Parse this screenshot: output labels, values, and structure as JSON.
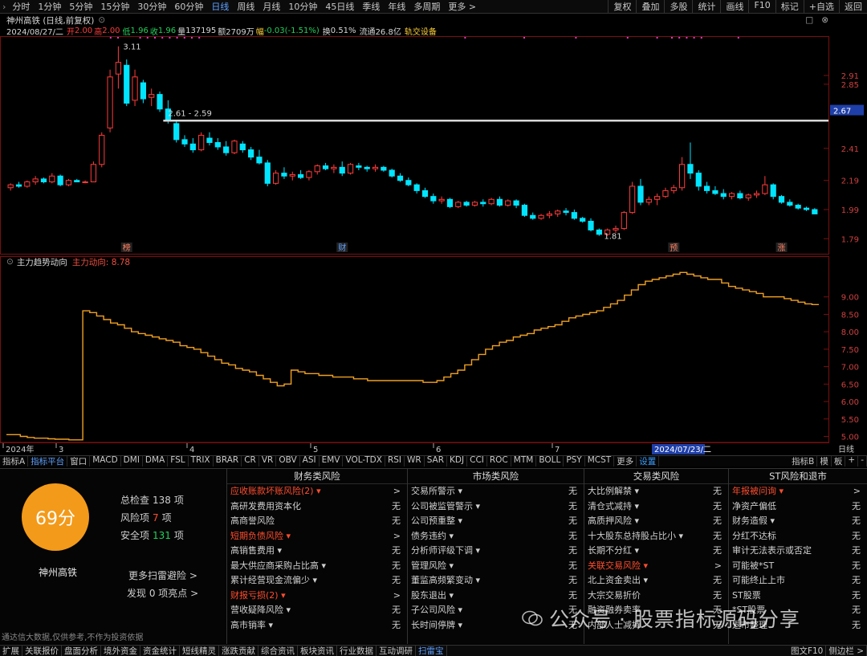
{
  "toolbar": {
    "timeframes": [
      "分时",
      "1分钟",
      "5分钟",
      "15分钟",
      "30分钟",
      "60分钟",
      "日线",
      "周线",
      "月线",
      "10分钟",
      "45日线",
      "季线",
      "年线",
      "多周期",
      "更多 >"
    ],
    "active_timeframe": "日线",
    "right_buttons": [
      "复权",
      "叠加",
      "多股",
      "统计",
      "画线",
      "F10",
      "标记",
      "+自选",
      "返回"
    ]
  },
  "header": {
    "title": "神州高铁 (日线,前复权)",
    "date": "2024/08/27/二",
    "open_label": "开",
    "open": "2.00",
    "high_label": "高",
    "high": "2.00",
    "low_label": "低",
    "low": "1.96",
    "close_label": "收",
    "close": "1.96",
    "volume_label": "量",
    "volume": "137195",
    "amount_label": "额",
    "amount": "2709万",
    "change_label": "幅",
    "change": "-0.03(-1.51%)",
    "turnover_label": "换",
    "turnover": "0.51%",
    "float_label": "流通",
    "float": "26.8亿",
    "sector": "轨交设备"
  },
  "price_chart": {
    "y_ticks": [
      "2.91",
      "2.85",
      "2.41",
      "2.19",
      "1.99",
      "1.79"
    ],
    "current_price_tag": "2.67",
    "peak_label": "3.11",
    "low_label": "1.81",
    "range_label": "2.61 - 2.59",
    "event_markers": [
      "榜",
      "财",
      "预",
      "涨"
    ]
  },
  "indicator": {
    "name": "主力趋势动向",
    "series_label": "主力动向: 8.78",
    "y_ticks": [
      "9.00",
      "8.50",
      "8.00",
      "7.50",
      "7.00",
      "6.50",
      "6.00",
      "5.50",
      "5.00"
    ]
  },
  "date_axis": {
    "labels": [
      "2024年",
      "3",
      "4",
      "5",
      "6",
      "7"
    ],
    "highlight_date": "2024/07/23/二",
    "right_label": "日线"
  },
  "indicator_tabs": {
    "items": [
      "指标A",
      "指标平台",
      "窗口",
      "MACD",
      "DMI",
      "DMA",
      "FSL",
      "TRIX",
      "BRAR",
      "CR",
      "VR",
      "OBV",
      "ASI",
      "EMV",
      "VOL-TDX",
      "RSI",
      "WR",
      "SAR",
      "KDJ",
      "CCI",
      "ROC",
      "MTM",
      "BOLL",
      "PSY",
      "MCST",
      "更多",
      "设置"
    ],
    "right_items": [
      "指标B",
      "模",
      "板",
      "+",
      "-"
    ]
  },
  "scan": {
    "score": "69分",
    "stock_name": "神州高铁",
    "total_label": "总检查",
    "total": "138",
    "total_unit": "项",
    "risk_label": "风险项",
    "risk": "7",
    "risk_unit": "项",
    "safe_label": "安全项",
    "safe": "131",
    "safe_unit": "项",
    "more_scan": "更多扫雷避险 >",
    "discover": "发现 0 项亮点 >",
    "disclaimer": "通达信大数据,仅供参考,不作为投资依据",
    "columns": [
      {
        "title": "财务类风险",
        "items": [
          {
            "label": "应收账款坏账风险(2) ▾",
            "value": ">",
            "hl": true
          },
          {
            "label": "高研发费用资本化",
            "value": "无",
            "hl": false
          },
          {
            "label": "高商誉风险",
            "value": "无",
            "hl": false
          },
          {
            "label": "短期负债风险 ▾",
            "value": ">",
            "hl": true
          },
          {
            "label": "高销售费用 ▾",
            "value": "无",
            "hl": false
          },
          {
            "label": "最大供应商采购占比高 ▾",
            "value": "无",
            "hl": false
          },
          {
            "label": "累计经营现金流偏少 ▾",
            "value": "无",
            "hl": false
          },
          {
            "label": "财报亏损(2) ▾",
            "value": ">",
            "hl": true
          },
          {
            "label": "营收疑降风险 ▾",
            "value": "无",
            "hl": false
          },
          {
            "label": "高市销率 ▾",
            "value": "无",
            "hl": false
          }
        ]
      },
      {
        "title": "市场类风险",
        "items": [
          {
            "label": "交易所警示 ▾",
            "value": "无",
            "hl": false
          },
          {
            "label": "公司被监管警示 ▾",
            "value": "无",
            "hl": false
          },
          {
            "label": "公司预重整 ▾",
            "value": "无",
            "hl": false
          },
          {
            "label": "债务违约 ▾",
            "value": "无",
            "hl": false
          },
          {
            "label": "分析师评级下调 ▾",
            "value": "无",
            "hl": false
          },
          {
            "label": "管理风险 ▾",
            "value": "无",
            "hl": false
          },
          {
            "label": "董监高频繁变动 ▾",
            "value": "无",
            "hl": false
          },
          {
            "label": "股东退出 ▾",
            "value": "无",
            "hl": false
          },
          {
            "label": "子公司风险 ▾",
            "value": "无",
            "hl": false
          },
          {
            "label": "长时间停牌 ▾",
            "value": "无",
            "hl": false
          }
        ]
      },
      {
        "title": "交易类风险",
        "items": [
          {
            "label": "大比例解禁 ▾",
            "value": "无",
            "hl": false
          },
          {
            "label": "清仓式减持 ▾",
            "value": "无",
            "hl": false
          },
          {
            "label": "高质押风险 ▾",
            "value": "无",
            "hl": false
          },
          {
            "label": "十大股东总持股占比小 ▾",
            "value": "无",
            "hl": false
          },
          {
            "label": "长期不分红 ▾",
            "value": "无",
            "hl": false
          },
          {
            "label": "关联交易风险 ▾",
            "value": ">",
            "hl": true
          },
          {
            "label": "北上资金卖出 ▾",
            "value": "无",
            "hl": false
          },
          {
            "label": "大宗交易折价",
            "value": "无",
            "hl": false
          },
          {
            "label": "融资融券卖率",
            "value": "无",
            "hl": false
          },
          {
            "label": "内部人士减持",
            "value": "无",
            "hl": false
          }
        ]
      },
      {
        "title": "ST风险和退市",
        "items": [
          {
            "label": "年报被问询 ▾",
            "value": ">",
            "hl": true
          },
          {
            "label": "净资产偏低",
            "value": "无",
            "hl": false
          },
          {
            "label": "财务造假 ▾",
            "value": "无",
            "hl": false
          },
          {
            "label": "分红不达标",
            "value": "无",
            "hl": false
          },
          {
            "label": "审计无法表示或否定",
            "value": "无",
            "hl": false
          },
          {
            "label": "可能被*ST",
            "value": "无",
            "hl": false
          },
          {
            "label": "可能终止上市",
            "value": "无",
            "hl": false
          },
          {
            "label": "ST股票",
            "value": "无",
            "hl": false
          },
          {
            "label": "*ST股票",
            "value": "无",
            "hl": false
          },
          {
            "label": "退市整理",
            "value": "无",
            "hl": false
          }
        ]
      }
    ]
  },
  "bottom_tabs": {
    "items": [
      "扩展",
      "关联报价",
      "盘面分析",
      "境外资金",
      "资金统计",
      "短线精灵",
      "涨跌贡献",
      "综合资讯",
      "板块资讯",
      "行业数据",
      "互动调研",
      "扫雷宝"
    ],
    "active": "扫雷宝",
    "right_items": [
      "图文F10",
      "侧边栏 >"
    ]
  },
  "watermark": "公众号 · 股票指标源码分享",
  "colors": {
    "up": "#ff3b3b",
    "down": "#00e5ff",
    "indicator_line": "#f0a020",
    "accent": "#5ea0ff",
    "score": "#f39a1a"
  },
  "chart_data": {
    "type": "candlestick",
    "candles": [
      [
        2.14,
        2.17,
        2.12,
        2.16
      ],
      [
        2.16,
        2.18,
        2.14,
        2.15
      ],
      [
        2.15,
        2.19,
        2.14,
        2.18
      ],
      [
        2.18,
        2.22,
        2.16,
        2.2
      ],
      [
        2.2,
        2.21,
        2.17,
        2.18
      ],
      [
        2.18,
        2.24,
        2.17,
        2.22
      ],
      [
        2.22,
        2.23,
        2.15,
        2.16
      ],
      [
        2.16,
        2.2,
        2.15,
        2.19
      ],
      [
        2.19,
        2.2,
        2.18,
        2.18
      ],
      [
        2.18,
        2.19,
        2.17,
        2.18
      ],
      [
        2.18,
        2.32,
        2.18,
        2.3
      ],
      [
        2.3,
        2.52,
        2.28,
        2.5
      ],
      [
        2.55,
        2.95,
        2.52,
        2.9
      ],
      [
        2.92,
        3.11,
        2.82,
        3.0
      ],
      [
        2.98,
        3.02,
        2.7,
        2.72
      ],
      [
        2.74,
        2.95,
        2.7,
        2.9
      ],
      [
        2.86,
        2.88,
        2.72,
        2.75
      ],
      [
        2.76,
        2.82,
        2.7,
        2.78
      ],
      [
        2.78,
        2.8,
        2.66,
        2.68
      ],
      [
        2.68,
        2.74,
        2.58,
        2.6
      ],
      [
        2.58,
        2.6,
        2.45,
        2.47
      ],
      [
        2.47,
        2.5,
        2.42,
        2.44
      ],
      [
        2.44,
        2.48,
        2.38,
        2.4
      ],
      [
        2.4,
        2.52,
        2.39,
        2.5
      ],
      [
        2.48,
        2.52,
        2.43,
        2.45
      ],
      [
        2.45,
        2.48,
        2.4,
        2.42
      ],
      [
        2.42,
        2.46,
        2.36,
        2.38
      ],
      [
        2.38,
        2.47,
        2.37,
        2.46
      ],
      [
        2.44,
        2.46,
        2.38,
        2.4
      ],
      [
        2.4,
        2.42,
        2.33,
        2.35
      ],
      [
        2.35,
        2.4,
        2.3,
        2.31
      ],
      [
        2.31,
        2.33,
        2.15,
        2.17
      ],
      [
        2.17,
        2.26,
        2.16,
        2.24
      ],
      [
        2.24,
        2.28,
        2.2,
        2.22
      ],
      [
        2.22,
        2.25,
        2.19,
        2.23
      ],
      [
        2.23,
        2.26,
        2.2,
        2.21
      ],
      [
        2.21,
        2.26,
        2.19,
        2.25
      ],
      [
        2.25,
        2.3,
        2.23,
        2.29
      ],
      [
        2.29,
        2.31,
        2.26,
        2.27
      ],
      [
        2.27,
        2.3,
        2.24,
        2.28
      ],
      [
        2.28,
        2.32,
        2.22,
        2.24
      ],
      [
        2.24,
        2.31,
        2.23,
        2.3
      ],
      [
        2.29,
        2.31,
        2.26,
        2.28
      ],
      [
        2.28,
        2.29,
        2.25,
        2.27
      ],
      [
        2.27,
        2.3,
        2.25,
        2.28
      ],
      [
        2.28,
        2.29,
        2.25,
        2.26
      ],
      [
        2.26,
        2.27,
        2.21,
        2.22
      ],
      [
        2.22,
        2.24,
        2.18,
        2.19
      ],
      [
        2.19,
        2.21,
        2.15,
        2.16
      ],
      [
        2.16,
        2.17,
        2.1,
        2.12
      ],
      [
        2.12,
        2.14,
        2.07,
        2.08
      ],
      [
        2.08,
        2.1,
        2.03,
        2.05
      ],
      [
        2.05,
        2.08,
        2.03,
        2.06
      ],
      [
        2.06,
        2.07,
        2.0,
        2.01
      ],
      [
        2.01,
        2.05,
        2.0,
        2.04
      ],
      [
        2.04,
        2.05,
        2.01,
        2.02
      ],
      [
        2.02,
        2.05,
        2.01,
        2.04
      ],
      [
        2.04,
        2.06,
        2.01,
        2.03
      ],
      [
        2.03,
        2.07,
        2.02,
        2.06
      ],
      [
        2.06,
        2.08,
        2.01,
        2.02
      ],
      [
        2.02,
        2.06,
        2.01,
        2.05
      ],
      [
        2.05,
        2.06,
        2.0,
        2.02
      ],
      [
        2.02,
        2.03,
        1.94,
        1.95
      ],
      [
        1.95,
        1.97,
        1.92,
        1.93
      ],
      [
        1.93,
        1.96,
        1.92,
        1.95
      ],
      [
        1.95,
        1.98,
        1.93,
        1.96
      ],
      [
        1.96,
        1.99,
        1.94,
        1.98
      ],
      [
        1.98,
        2.0,
        1.95,
        1.97
      ],
      [
        1.97,
        1.99,
        1.92,
        1.93
      ],
      [
        1.93,
        1.94,
        1.9,
        1.91
      ],
      [
        1.91,
        1.93,
        1.84,
        1.85
      ],
      [
        1.85,
        1.86,
        1.81,
        1.82
      ],
      [
        1.82,
        1.86,
        1.81,
        1.85
      ],
      [
        1.85,
        1.88,
        1.83,
        1.86
      ],
      [
        1.86,
        1.98,
        1.85,
        1.97
      ],
      [
        1.97,
        2.18,
        1.96,
        2.15
      ],
      [
        2.15,
        2.2,
        2.02,
        2.04
      ],
      [
        2.04,
        2.08,
        2.02,
        2.06
      ],
      [
        2.06,
        2.1,
        2.02,
        2.08
      ],
      [
        2.08,
        2.14,
        2.07,
        2.12
      ],
      [
        2.12,
        2.16,
        2.1,
        2.14
      ],
      [
        2.14,
        2.35,
        2.12,
        2.3
      ],
      [
        2.3,
        2.45,
        2.2,
        2.24
      ],
      [
        2.24,
        2.26,
        2.12,
        2.15
      ],
      [
        2.15,
        2.18,
        2.1,
        2.12
      ],
      [
        2.12,
        2.15,
        2.09,
        2.1
      ],
      [
        2.1,
        2.13,
        2.06,
        2.08
      ],
      [
        2.08,
        2.11,
        2.06,
        2.1
      ],
      [
        2.1,
        2.12,
        2.06,
        2.07
      ],
      [
        2.07,
        2.1,
        2.05,
        2.09
      ],
      [
        2.09,
        2.12,
        2.07,
        2.1
      ],
      [
        2.1,
        2.22,
        2.09,
        2.16
      ],
      [
        2.16,
        2.17,
        2.06,
        2.08
      ],
      [
        2.08,
        2.09,
        2.03,
        2.04
      ],
      [
        2.04,
        2.06,
        2.01,
        2.02
      ],
      [
        2.02,
        2.03,
        1.99,
        2.0
      ],
      [
        2.0,
        2.01,
        1.98,
        1.99
      ],
      [
        1.99,
        2.0,
        1.96,
        1.96
      ]
    ],
    "resistance_level": 2.6,
    "indicator_series": {
      "name": "主力动向",
      "values": [
        5.05,
        5.05,
        5.0,
        4.97,
        4.95,
        4.95,
        4.93,
        4.92,
        4.92,
        4.9,
        4.9,
        8.6,
        8.55,
        8.45,
        8.35,
        8.25,
        8.2,
        8.1,
        8.0,
        7.95,
        7.9,
        7.85,
        7.8,
        7.75,
        7.7,
        7.6,
        7.55,
        7.5,
        7.4,
        7.3,
        7.2,
        7.1,
        7.05,
        6.95,
        6.9,
        6.85,
        6.75,
        6.65,
        6.55,
        6.45,
        6.5,
        6.9,
        6.85,
        6.8,
        6.8,
        6.75,
        6.75,
        6.7,
        6.7,
        6.7,
        6.65,
        6.65,
        6.6,
        6.6,
        6.6,
        6.6,
        6.6,
        6.6,
        6.6,
        6.6,
        6.55,
        6.55,
        6.6,
        6.7,
        6.8,
        6.9,
        7.05,
        7.2,
        7.35,
        7.5,
        7.6,
        7.7,
        7.75,
        7.85,
        7.9,
        7.95,
        8.05,
        8.1,
        8.15,
        8.2,
        8.3,
        8.4,
        8.45,
        8.5,
        8.55,
        8.6,
        8.7,
        8.8,
        8.9,
        9.05,
        9.2,
        9.35,
        9.45,
        9.5,
        9.55,
        9.6,
        9.65,
        9.7,
        9.65,
        9.6,
        9.55,
        9.5,
        9.5,
        9.4,
        9.3,
        9.25,
        9.2,
        9.15,
        9.1,
        9.0,
        9.0,
        9.0,
        8.95,
        8.9,
        8.85,
        8.8,
        8.78
      ]
    },
    "y_range_price": [
      1.72,
      3.18
    ],
    "y_range_indicator": [
      4.85,
      9.8
    ]
  }
}
